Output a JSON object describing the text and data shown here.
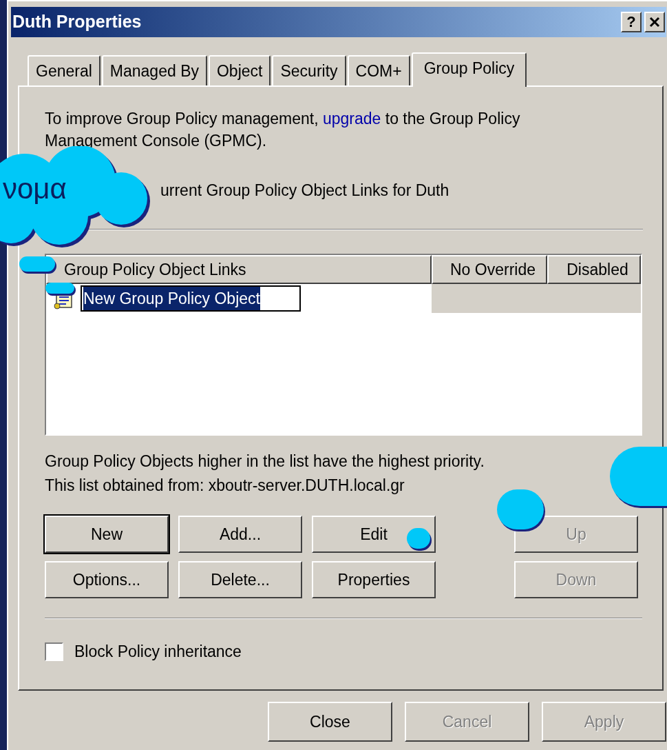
{
  "window": {
    "title": "Duth Properties",
    "help_button": "?"
  },
  "tabs": [
    {
      "label": "General",
      "selected": false
    },
    {
      "label": "Managed By",
      "selected": false
    },
    {
      "label": "Object",
      "selected": false
    },
    {
      "label": "Security",
      "selected": false
    },
    {
      "label": "COM+",
      "selected": false
    },
    {
      "label": "Group Policy",
      "selected": true
    }
  ],
  "intro": {
    "before": "To improve Group Policy management, ",
    "link": "upgrade",
    "after": " to the Group Policy Management Console (GPMC)."
  },
  "links_label": "urrent Group Policy Object Links for Duth",
  "list": {
    "columns": [
      "Group Policy Object Links",
      "No Override",
      "Disabled"
    ],
    "rows": [
      {
        "name": "New Group Policy Object",
        "editing": true
      }
    ]
  },
  "info": [
    "Group Policy Objects higher in the list have the highest priority.",
    "This list obtained from: xboutr-server.DUTH.local.gr"
  ],
  "buttons": [
    {
      "label": "New",
      "default": true,
      "disabled": false
    },
    {
      "label": "Add...",
      "default": false,
      "disabled": false
    },
    {
      "label": "Edit",
      "default": false,
      "disabled": false
    },
    {
      "label": "Up",
      "default": false,
      "disabled": true
    },
    {
      "label": "Options...",
      "default": false,
      "disabled": false
    },
    {
      "label": "Delete...",
      "default": false,
      "disabled": false
    },
    {
      "label": "Properties",
      "default": false,
      "disabled": false
    },
    {
      "label": "Down",
      "default": false,
      "disabled": true
    }
  ],
  "checkbox": {
    "label": "Block Policy inheritance",
    "checked": false
  },
  "footer_buttons": [
    {
      "label": "Close",
      "disabled": false
    },
    {
      "label": "Cancel",
      "disabled": true
    },
    {
      "label": "Apply",
      "disabled": true
    }
  ],
  "callout": {
    "text": "νομα"
  }
}
